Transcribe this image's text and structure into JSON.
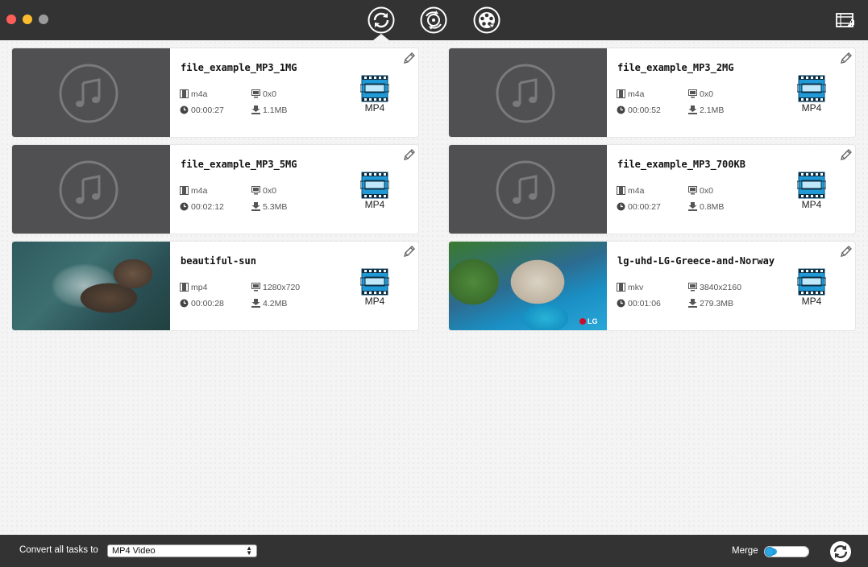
{
  "toolbar": {
    "buttons": [
      {
        "icon": "convert-icon",
        "active": true
      },
      {
        "icon": "rip-disc-icon",
        "active": false
      },
      {
        "icon": "download-film-icon",
        "active": false
      }
    ],
    "media_browser_icon": "media-browser-icon"
  },
  "tasks": [
    {
      "name": "file_example_MP3_1MG",
      "format": "m4a",
      "resolution": "0x0",
      "duration": "00:00:27",
      "size": "1.1MB",
      "output": "MP4",
      "thumb": "music"
    },
    {
      "name": "file_example_MP3_2MG",
      "format": "m4a",
      "resolution": "0x0",
      "duration": "00:00:52",
      "size": "2.1MB",
      "output": "MP4",
      "thumb": "music"
    },
    {
      "name": "file_example_MP3_5MG",
      "format": "m4a",
      "resolution": "0x0",
      "duration": "00:02:12",
      "size": "5.3MB",
      "output": "MP4",
      "thumb": "music"
    },
    {
      "name": "file_example_MP3_700KB",
      "format": "m4a",
      "resolution": "0x0",
      "duration": "00:00:27",
      "size": "0.8MB",
      "output": "MP4",
      "thumb": "music"
    },
    {
      "name": "beautiful-sun",
      "format": "mp4",
      "resolution": "1280x720",
      "duration": "00:00:28",
      "size": "4.2MB",
      "output": "MP4",
      "thumb": "sea"
    },
    {
      "name": "lg-uhd-LG-Greece-and-Norway",
      "format": "mkv",
      "resolution": "3840x2160",
      "duration": "00:01:06",
      "size": "279.3MB",
      "output": "MP4",
      "thumb": "beach"
    }
  ],
  "thumb_overlay": {
    "lg_logo": "LG"
  },
  "bottom": {
    "convert_label": "Convert all tasks to",
    "convert_value": "MP4 Video",
    "merge_label": "Merge",
    "merge_on": true
  },
  "colors": {
    "bar": "#333333",
    "accent": "#2aa7e6",
    "background": "#f4f4f4"
  }
}
